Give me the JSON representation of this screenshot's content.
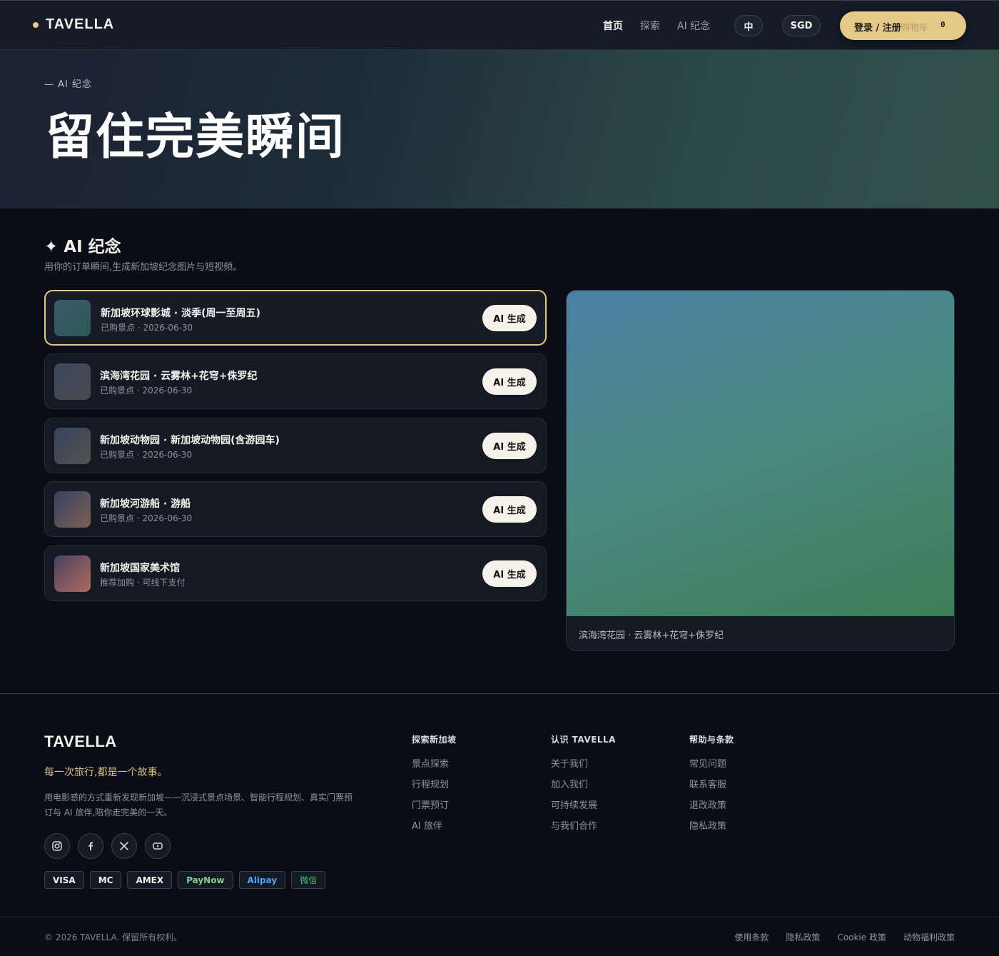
{
  "nav": {
    "brand": "TAVELLA",
    "links": [
      "首页",
      "探索",
      "AI 纪念"
    ],
    "lang": "中",
    "currency": "SGD",
    "login": "登录 / 注册",
    "cart": "购物车",
    "cart_count": "0"
  },
  "hero": {
    "eyebrow": "— AI 纪念",
    "title": "留住完美瞬间"
  },
  "section": {
    "title": "✦ AI 纪念",
    "subtitle": "用你的订单瞬间,生成新加坡纪念图片与短视频。"
  },
  "items": [
    {
      "name": "新加坡环球影城 · 淡季(周一至周五)",
      "meta": "已购景点 · 2026-06-30",
      "button": "AI 生成"
    },
    {
      "name": "滨海湾花园 · 云雾林+花穹+侏罗纪",
      "meta": "已购景点 · 2026-06-30",
      "button": "AI 生成"
    },
    {
      "name": "新加坡动物园 · 新加坡动物园(含游园车)",
      "meta": "已购景点 · 2026-06-30",
      "button": "AI 生成"
    },
    {
      "name": "新加坡河游船 · 游船",
      "meta": "已购景点 · 2026-06-30",
      "button": "AI 生成"
    },
    {
      "name": "新加坡国家美术馆",
      "meta": "推荐加购 · 可线下支付",
      "button": "AI 生成"
    }
  ],
  "preview": {
    "caption": "滨海湾花园 · 云雾林+花穹+侏罗纪"
  },
  "footer": {
    "brand": "TAVELLA",
    "tagline": "每一次旅行,都是一个故事。",
    "description": "用电影感的方式重新发现新加坡——沉浸式景点场景、智能行程规划、真实门票预订与 AI 旅伴,陪你走完美的一天。",
    "social_icons": [
      "instagram-icon",
      "facebook-icon",
      "x-icon",
      "youtube-icon"
    ],
    "payments": [
      "VISA",
      "MC",
      "AMEX",
      "PayNow",
      "Alipay",
      "微信"
    ],
    "payment_colors": {
      "PayNow": "#7fd08a",
      "Alipay": "#4aa3ff",
      "微信": "#46c46a"
    },
    "columns": [
      {
        "heading": "探索新加坡",
        "links": [
          "景点探索",
          "行程规划",
          "门票预订",
          "AI 旅伴"
        ]
      },
      {
        "heading": "认识 TAVELLA",
        "links": [
          "关于我们",
          "加入我们",
          "可持续发展",
          "与我们合作"
        ]
      },
      {
        "heading": "帮助与条款",
        "links": [
          "常见问题",
          "联系客服",
          "退改政策",
          "隐私政策"
        ]
      }
    ],
    "copyright": "© 2026 TAVELLA. 保留所有权利。",
    "legal": [
      "使用条款",
      "隐私政策",
      "Cookie 政策",
      "动物福利政策"
    ]
  },
  "colors": {
    "accent": "#e6c987",
    "background": "#0a0d16"
  }
}
